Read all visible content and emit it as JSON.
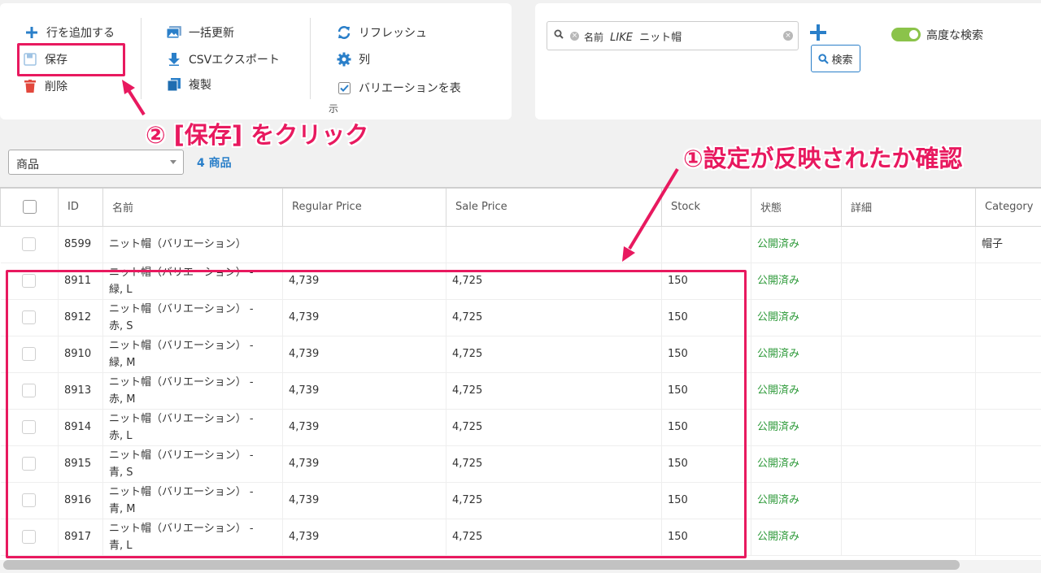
{
  "toolbar": {
    "add_row": "行を追加する",
    "save": "保存",
    "delete": "削除",
    "bulk_update": "一括更新",
    "csv_export": "CSVエクスポート",
    "duplicate": "複製",
    "refresh": "リフレッシュ",
    "columns": "列",
    "show_variations": "バリエーションを表",
    "show_variations_wrap": "示"
  },
  "search": {
    "chip_field": "名前",
    "chip_op": "LIKE",
    "chip_value": "ニット帽",
    "search_button": "検索",
    "advanced_label": "高度な検索"
  },
  "filter": {
    "post_type": "商品",
    "count": "4 商品"
  },
  "table": {
    "headers": [
      "ID",
      "名前",
      "Regular Price",
      "Sale Price",
      "Stock",
      "状態",
      "詳細",
      "Category"
    ],
    "rows": [
      {
        "id": "8599",
        "name1": "ニット帽（バリエーション）",
        "name2": "",
        "regular": "",
        "sale": "",
        "stock": "",
        "status": "公開済み",
        "detail": "",
        "category": "帽子"
      },
      {
        "id": "8911",
        "name1": "ニット帽（バリエーション） -",
        "name2": "緑, L",
        "regular": "4,739",
        "sale": "4,725",
        "stock": "150",
        "status": "公開済み",
        "detail": "",
        "category": ""
      },
      {
        "id": "8912",
        "name1": "ニット帽（バリエーション） -",
        "name2": "赤, S",
        "regular": "4,739",
        "sale": "4,725",
        "stock": "150",
        "status": "公開済み",
        "detail": "",
        "category": ""
      },
      {
        "id": "8910",
        "name1": "ニット帽（バリエーション） -",
        "name2": "緑, M",
        "regular": "4,739",
        "sale": "4,725",
        "stock": "150",
        "status": "公開済み",
        "detail": "",
        "category": ""
      },
      {
        "id": "8913",
        "name1": "ニット帽（バリエーション） -",
        "name2": "赤, M",
        "regular": "4,739",
        "sale": "4,725",
        "stock": "150",
        "status": "公開済み",
        "detail": "",
        "category": ""
      },
      {
        "id": "8914",
        "name1": "ニット帽（バリエーション） -",
        "name2": "赤, L",
        "regular": "4,739",
        "sale": "4,725",
        "stock": "150",
        "status": "公開済み",
        "detail": "",
        "category": ""
      },
      {
        "id": "8915",
        "name1": "ニット帽（バリエーション） -",
        "name2": "青, S",
        "regular": "4,739",
        "sale": "4,725",
        "stock": "150",
        "status": "公開済み",
        "detail": "",
        "category": ""
      },
      {
        "id": "8916",
        "name1": "ニット帽（バリエーション） -",
        "name2": "青, M",
        "regular": "4,739",
        "sale": "4,725",
        "stock": "150",
        "status": "公開済み",
        "detail": "",
        "category": ""
      },
      {
        "id": "8917",
        "name1": "ニット帽（バリエーション） -",
        "name2": "青, L",
        "regular": "4,739",
        "sale": "4,725",
        "stock": "150",
        "status": "公開済み",
        "detail": "",
        "category": ""
      }
    ]
  },
  "annotations": {
    "step2": "② [保存] をクリック",
    "step1": "①設定が反映されたか確認"
  },
  "colors": {
    "accent": "#2a7fc9",
    "annotation": "#e8195f",
    "status_green": "#2e9a3a",
    "toggle_green": "#8bc34a",
    "delete_red": "#e2483d"
  },
  "icons": {
    "add_row": "plus-icon",
    "save": "floppy-disk-icon",
    "delete": "trash-icon",
    "bulk_update": "image-stack-icon",
    "csv_export": "download-arrow-icon",
    "duplicate": "copy-icon",
    "refresh": "refresh-icon",
    "columns": "gear-icon",
    "show_variations": "checkbox-checked-icon",
    "search": "magnifier-icon"
  }
}
